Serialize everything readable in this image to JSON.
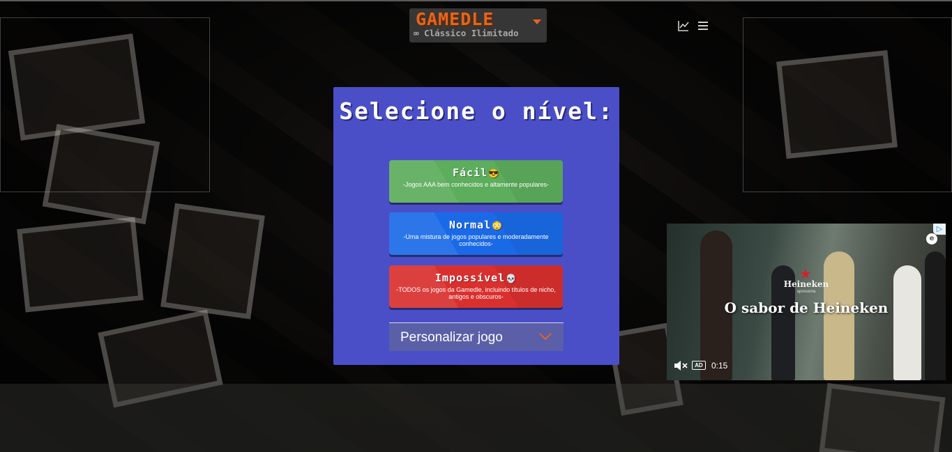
{
  "header": {
    "logo_title": "GAMEDLE",
    "logo_subtitle": "∞ Clássico Ilimitado",
    "stats_icon": "line-chart-icon",
    "menu_icon": "hamburger-menu-icon"
  },
  "modal": {
    "title": "Selecione o nível:",
    "levels": [
      {
        "name": "Fácil",
        "emoji": "😎",
        "description": "-Jogos AAA bem conhecidos e altamente populares-",
        "color": "#5cad5c"
      },
      {
        "name": "Normal",
        "emoji": "😳",
        "description": "-Uma mistura de jogos populares e moderadamente conhecidos-",
        "color": "#1a6ae8"
      },
      {
        "name": "Impossível",
        "emoji": "💀",
        "description": "-TODOS os jogos da Gamedle, incluindo títulos de nicho, antigos e obscuros-",
        "color": "#d9302e"
      }
    ],
    "customize_label": "Personalizar jogo",
    "customize_icon": "chevron-down-icon",
    "background_color": "#4a4fc8"
  },
  "video_ad": {
    "brand": "Heineken",
    "brand_sub": "apresenta",
    "headline": "O sabor de Heineken",
    "ad_badge": "AD",
    "time": "0:15",
    "adchoices_icon": "adchoices-icon",
    "mute_icon": "muted-speaker-icon"
  },
  "colors": {
    "accent_orange": "#e8641b"
  }
}
